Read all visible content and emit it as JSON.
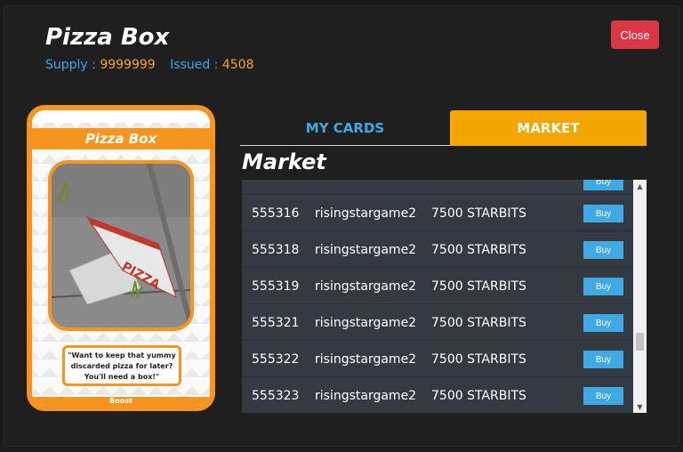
{
  "header": {
    "title": "Pizza Box",
    "supply_label": "Supply : ",
    "supply_value": "9999999",
    "issued_label": "Issued : ",
    "issued_value": "4508",
    "close_label": "Close"
  },
  "card": {
    "name": "Pizza Box",
    "description": "\"Want to keep that yummy discarded pizza for later? You'll need a box!\"",
    "footer": "Boost",
    "art_text": "PIZZA"
  },
  "tabs": [
    {
      "label": "MY CARDS",
      "active": false
    },
    {
      "label": "MARKET",
      "active": true
    }
  ],
  "market": {
    "title": "Market",
    "buy_label": "Buy",
    "rows": [
      {
        "id": "555316",
        "user": "risingstargame2",
        "price": "7500 STARBITS"
      },
      {
        "id": "555318",
        "user": "risingstargame2",
        "price": "7500 STARBITS"
      },
      {
        "id": "555319",
        "user": "risingstargame2",
        "price": "7500 STARBITS"
      },
      {
        "id": "555321",
        "user": "risingstargame2",
        "price": "7500 STARBITS"
      },
      {
        "id": "555322",
        "user": "risingstargame2",
        "price": "7500 STARBITS"
      },
      {
        "id": "555323",
        "user": "risingstargame2",
        "price": "7500 STARBITS"
      }
    ]
  },
  "colors": {
    "accent_orange": "#f5a500",
    "accent_blue": "#3fa9e6",
    "close_red": "#dc3545"
  }
}
